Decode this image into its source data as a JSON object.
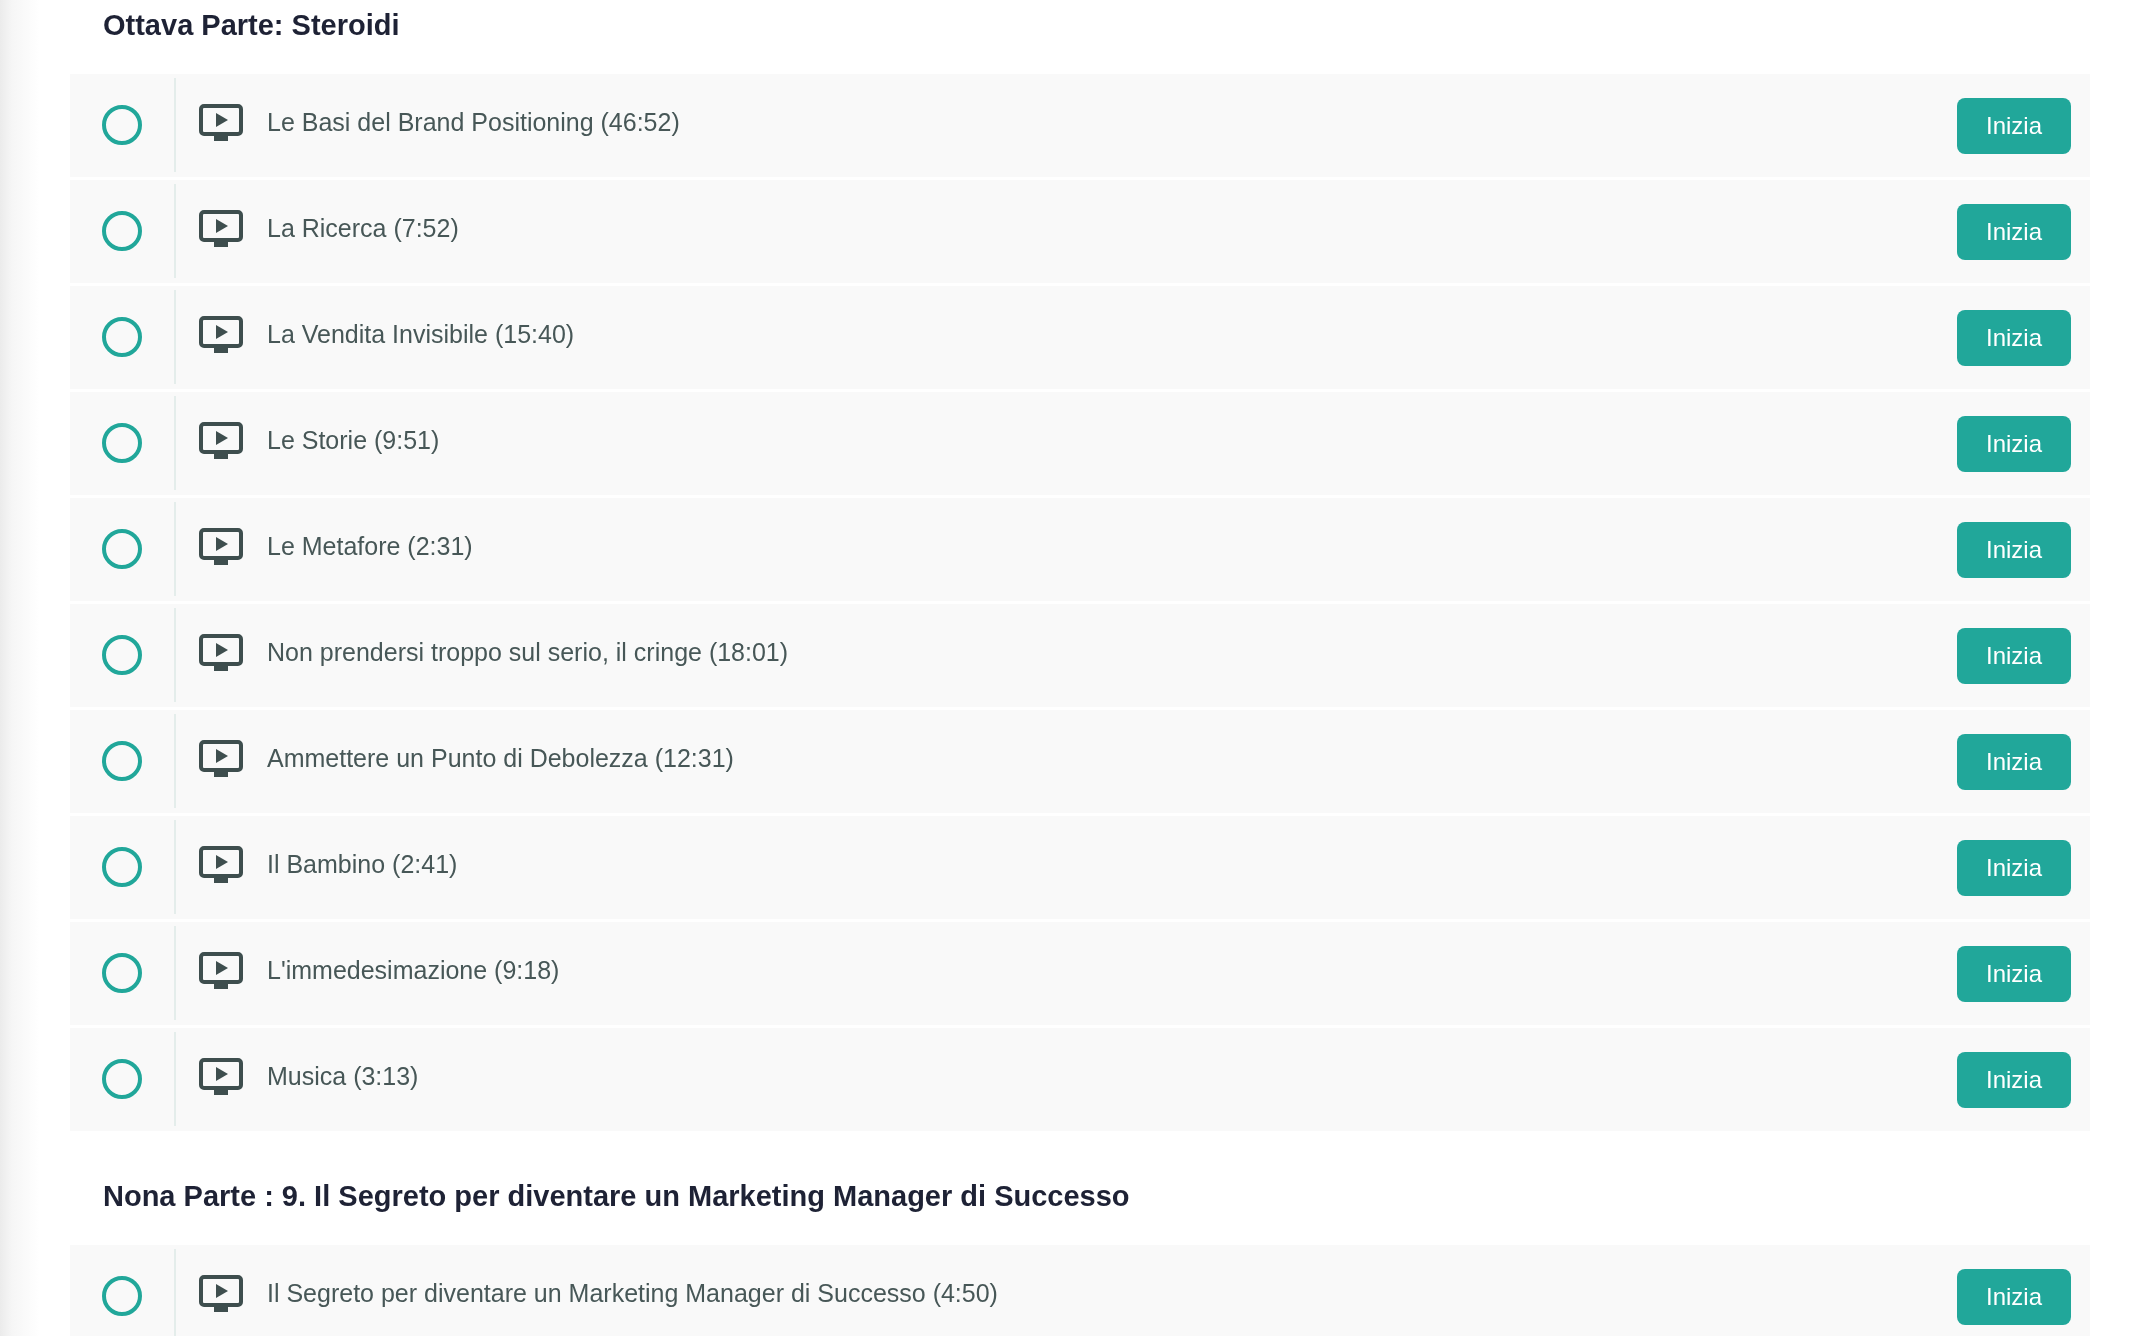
{
  "sections": [
    {
      "title": "Ottava Parte: Steroidi",
      "lessons": [
        {
          "title": "Le Basi del Brand Positioning (46:52)",
          "completed": false,
          "action": "Inizia"
        },
        {
          "title": "La Ricerca (7:52)",
          "completed": false,
          "action": "Inizia"
        },
        {
          "title": "La Vendita Invisibile (15:40)",
          "completed": false,
          "action": "Inizia"
        },
        {
          "title": "Le Storie (9:51)",
          "completed": false,
          "action": "Inizia"
        },
        {
          "title": "Le Metafore (2:31)",
          "completed": false,
          "action": "Inizia"
        },
        {
          "title": "Non prendersi troppo sul serio, il cringe (18:01)",
          "completed": false,
          "action": "Inizia"
        },
        {
          "title": "Ammettere un Punto di Debolezza (12:31)",
          "completed": false,
          "action": "Inizia"
        },
        {
          "title": "Il Bambino (2:41)",
          "completed": false,
          "action": "Inizia"
        },
        {
          "title": "L'immedesimazione (9:18)",
          "completed": false,
          "action": "Inizia"
        },
        {
          "title": "Musica (3:13)",
          "completed": false,
          "action": "Inizia"
        }
      ]
    },
    {
      "title": "Nona Parte : 9. Il Segreto per diventare un Marketing Manager di Successo",
      "lessons": [
        {
          "title": "Il Segreto per diventare un Marketing Manager di Successo (4:50)",
          "completed": false,
          "action": "Inizia"
        }
      ]
    }
  ]
}
